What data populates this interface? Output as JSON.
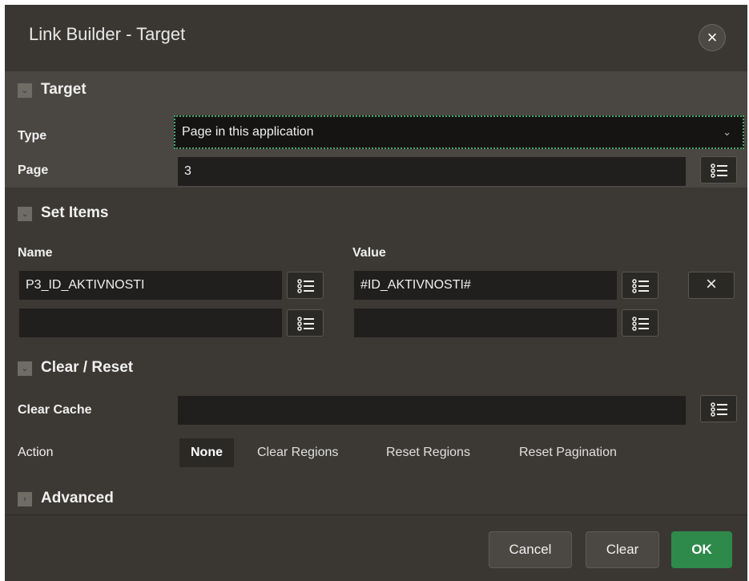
{
  "dialog": {
    "title": "Link Builder - Target",
    "close_icon": "close-icon"
  },
  "sections": {
    "target": "Target",
    "set_items": "Set Items",
    "clear_reset": "Clear / Reset",
    "advanced": "Advanced"
  },
  "target": {
    "type_label": "Type",
    "type_value": "Page in this application",
    "page_label": "Page",
    "page_value": "3"
  },
  "set_items": {
    "name_header": "Name",
    "value_header": "Value",
    "rows": [
      {
        "name": "P3_ID_AKTIVNOSTI",
        "value": "#ID_AKTIVNOSTI#"
      },
      {
        "name": "",
        "value": ""
      }
    ]
  },
  "clear_reset": {
    "clear_cache_label": "Clear Cache",
    "clear_cache_value": "",
    "action_label": "Action",
    "actions": [
      "None",
      "Clear Regions",
      "Reset Regions",
      "Reset Pagination"
    ],
    "selected_action": "None"
  },
  "footer": {
    "cancel": "Cancel",
    "clear": "Clear",
    "ok": "OK"
  },
  "colors": {
    "dialog_bg": "#3a3733",
    "primary": "#2e8a4a",
    "focus_border": "#49a56b"
  }
}
